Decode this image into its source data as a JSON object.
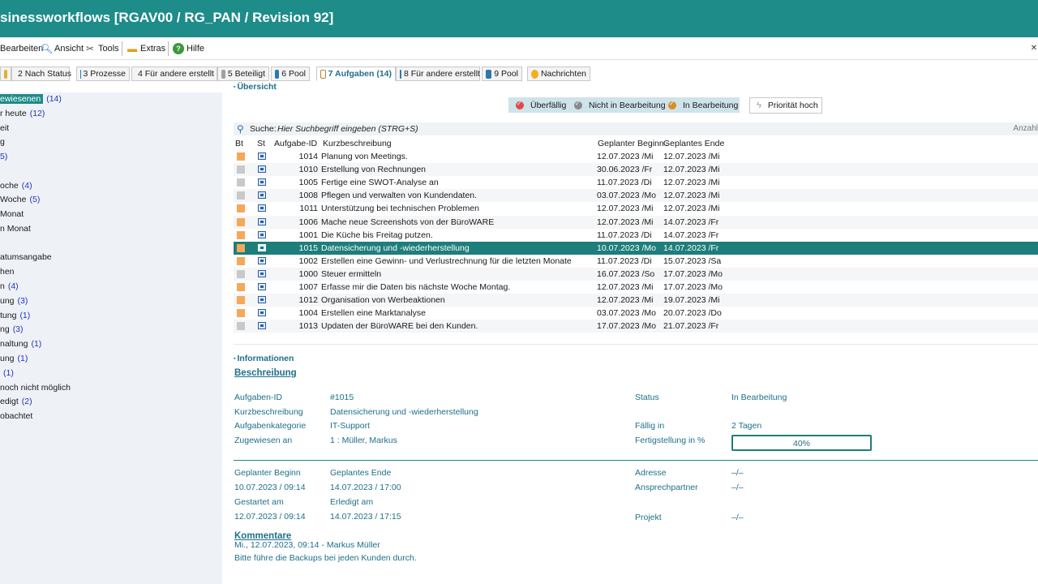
{
  "window": {
    "title": "sinessworkflows [RGAV00 / RG_PAN / Revision 92]"
  },
  "menu": [
    {
      "label": "Bearbeiten",
      "icon": "edit-icon"
    },
    {
      "label": "Ansicht",
      "icon": "view-icon"
    },
    {
      "label": "Tools",
      "icon": "tools-icon"
    },
    {
      "label": "Extras",
      "icon": "folder-icon"
    },
    {
      "label": "Hilfe",
      "icon": "help-icon"
    }
  ],
  "tabs": [
    {
      "label": "2 Nach Status"
    },
    {
      "label": "3 Prozesse"
    },
    {
      "label": "4 Für andere erstellt"
    },
    {
      "label": "5 Beteiligt"
    },
    {
      "label": "6 Pool"
    },
    {
      "label": "7 Aufgaben (14)"
    },
    {
      "label": "8 Für andere erstellt"
    },
    {
      "label": "9 Pool"
    },
    {
      "label": "Nachrichten"
    }
  ],
  "sidebar": [
    {
      "label": "ewiesenen",
      "count": "(14)",
      "selected": true
    },
    {
      "label": "r heute",
      "count": "(12)"
    },
    {
      "label": "eit",
      "count": ""
    },
    {
      "label": "g",
      "count": ""
    },
    {
      "label": "5)",
      "count": ""
    },
    {
      "label": "oche",
      "count": "(4)"
    },
    {
      "label": "Woche",
      "count": "(5)"
    },
    {
      "label": "Monat",
      "count": ""
    },
    {
      "label": "n Monat",
      "count": ""
    },
    {
      "label": "atumsangabe",
      "count": ""
    },
    {
      "label": "hen",
      "count": ""
    },
    {
      "label": "n",
      "count": "(4)"
    },
    {
      "label": "ung",
      "count": "(3)"
    },
    {
      "label": "tung",
      "count": "(1)"
    },
    {
      "label": "ng",
      "count": "(3)"
    },
    {
      "label": "naltung",
      "count": "(1)"
    },
    {
      "label": "ung",
      "count": "(1)"
    },
    {
      "label": "",
      "count": "(1)"
    },
    {
      "label": "noch nicht möglich",
      "count": ""
    },
    {
      "label": "edigt",
      "count": "(2)"
    },
    {
      "label": "obachtet",
      "count": ""
    }
  ],
  "overview": {
    "heading": "Übersicht",
    "filters": {
      "overdue": "Überfällig",
      "not_in_progress": "Nicht in Bearbeitung",
      "in_progress": "In Bearbeitung",
      "high_priority": "Priorität hoch"
    },
    "search": {
      "label": "Suche:",
      "placeholder": "Hier Suchbegriff eingeben (STRG+S)",
      "count_label": "Anzahl"
    },
    "columns": {
      "bt": "Bt",
      "st": "St",
      "id": "Aufgabe-ID",
      "desc": "Kurzbeschreibung",
      "begin": "Geplanter Beginn",
      "end": "Geplantes Ende"
    },
    "rows": [
      {
        "color": "#f5a85a",
        "id": "1014",
        "desc": "Planung von Meetings.",
        "begin": "12.07.2023 /Mi",
        "end": "12.07.2023 /Mi"
      },
      {
        "color": "#c9c9c9",
        "id": "1010",
        "desc": "Erstellung von Rechnungen",
        "begin": "30.06.2023 /Fr",
        "end": "12.07.2023 /Mi"
      },
      {
        "color": "#c9c9c9",
        "id": "1005",
        "desc": "Fertige eine SWOT-Analyse an",
        "begin": "11.07.2023 /Di",
        "end": "12.07.2023 /Mi"
      },
      {
        "color": "#c9c9c9",
        "id": "1008",
        "desc": "Pflegen und verwalten von Kundendaten.",
        "begin": "03.07.2023 /Mo",
        "end": "12.07.2023 /Mi"
      },
      {
        "color": "#f5a85a",
        "id": "1011",
        "desc": "Unterstützung bei technischen Problemen",
        "begin": "12.07.2023 /Mi",
        "end": "12.07.2023 /Mi"
      },
      {
        "color": "#f5a85a",
        "id": "1006",
        "desc": "Mache neue Screenshots von der BüroWARE",
        "begin": "12.07.2023 /Mi",
        "end": "14.07.2023 /Fr"
      },
      {
        "color": "#f5a85a",
        "id": "1001",
        "desc": "Die Küche bis Freitag putzen.",
        "begin": "11.07.2023 /Di",
        "end": "14.07.2023 /Fr"
      },
      {
        "color": "#f5a85a",
        "id": "1015",
        "desc": "Datensicherung und -wiederherstellung",
        "begin": "10.07.2023 /Mo",
        "end": "14.07.2023 /Fr",
        "selected": true
      },
      {
        "color": "#f5a85a",
        "id": "1002",
        "desc": "Erstellen eine Gewinn- und Verlustrechnung für die letzten Monate",
        "begin": "11.07.2023 /Di",
        "end": "15.07.2023 /Sa"
      },
      {
        "color": "#c9c9c9",
        "id": "1000",
        "desc": "Steuer ermitteln",
        "begin": "16.07.2023 /So",
        "end": "17.07.2023 /Mo"
      },
      {
        "color": "#f5a85a",
        "id": "1007",
        "desc": "Erfasse  mir die Daten bis nächste Woche Montag.",
        "begin": "12.07.2023 /Mi",
        "end": "17.07.2023 /Mo"
      },
      {
        "color": "#f5a85a",
        "id": "1012",
        "desc": "Organisation von Werbeaktionen",
        "begin": "12.07.2023 /Mi",
        "end": "19.07.2023 /Mi"
      },
      {
        "color": "#f5a85a",
        "id": "1004",
        "desc": "Erstellen eine Marktanalyse",
        "begin": "03.07.2023 /Mo",
        "end": "20.07.2023 /Do"
      },
      {
        "color": "#c9c9c9",
        "id": "1013",
        "desc": "Updaten der BüroWARE bei den Kunden.",
        "begin": "17.07.2023 /Mo",
        "end": "21.07.2023 /Fr"
      }
    ]
  },
  "info": {
    "heading": "Informationen",
    "section_title": "Beschreibung",
    "task_id_label": "Aufgaben-ID",
    "task_id": "#1015",
    "short_desc_label": "Kurzbeschreibung",
    "short_desc": "Datensicherung und -wiederherstellung",
    "category_label": "Aufgabenkategorie",
    "category": "IT-Support",
    "assigned_label": "Zugewiesen an",
    "assigned": "1 : Müller, Markus",
    "status_label": "Status",
    "status": "In Bearbeitung",
    "due_label": "Fällig in",
    "due": "2 Tagen",
    "completion_label": "Fertigstellung in %",
    "completion": "40%",
    "completion_fraction": 0.4,
    "planned_begin_label": "Geplanter Beginn",
    "planned_begin": "10.07.2023 / 09:14",
    "planned_end_label": "Geplantes Ende",
    "planned_end": "14.07.2023 / 17:00",
    "started_label": "Gestartet am",
    "started": "12.07.2023 / 09:14",
    "done_label": "Erledigt am",
    "done": "14.07.2023 / 17:15",
    "address_label": "Adresse",
    "address": "–/–",
    "contact_label": "Ansprechpartner",
    "contact": "–/–",
    "project_label": "Projekt",
    "project": "–/–",
    "comments_title": "Kommentare",
    "comment_meta": "Mi., 12.07.2023, 09:14 - Markus Müller",
    "comment_text": "Bitte führe die Backups bei jeden Kunden durch."
  },
  "colors": {
    "accent": "#1e8c89",
    "selected_row": "#1e7e7b",
    "sidebar_bg": "#eef2f7"
  }
}
